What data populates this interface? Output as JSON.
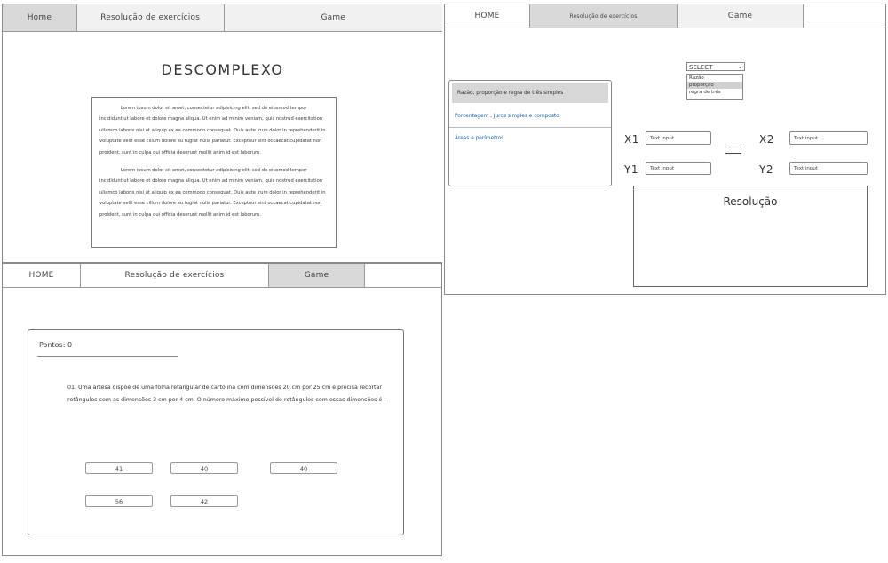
{
  "home_page": {
    "nav": [
      "Home",
      "Resolução de exercícios",
      "Game"
    ],
    "title": "DESCOMPLEXO",
    "paragraphs": [
      "Lorem ipsum dolor sit amet, consectetur adipisicing elit, sed do eiusmod tempor incididunt ut labore et dolore magna aliqua. Ut enim ad minim veniam, quis nostrud exercitation ullamco laboris nisi ut aliquip ex ea commodo consequat. Duis aute irure dolor in reprehenderit in voluptate velit esse cillum dolore eu fugiat nulla pariatur. Excepteur sint occaecat cupidatat non proident, sunt in culpa qui officia deserunt mollit anim id est laborum.",
      "Lorem ipsum dolor sit amet, consectetur adipisicing elit, sed do eiusmod tempor incididunt ut labore et dolore magna aliqua. Ut enim ad minim veniam, quis nostrud exercitation ullamco laboris nisi ut aliquip ex ea commodo consequat. Duis aute irure dolor in reprehenderit in voluptate velit esse cillum dolore eu fugiat nulla pariatur. Excepteur sint occaecat cupidatat non proident, sunt in culpa qui officia deserunt mollit anim id est laborum."
    ]
  },
  "exercises_page": {
    "nav": [
      "HOME",
      "Resolução de exercícios",
      "Game"
    ],
    "select": {
      "value": "SELECT",
      "options": [
        "Razão",
        "proporção",
        "regra de três"
      ],
      "selected_option": "proporção"
    },
    "menu_items": [
      "Razão, proporção e regra de três simples",
      "Porcentagem , Juros simples e composto",
      "Áreas e perímetros"
    ],
    "labels": {
      "x1": "X1",
      "x2": "X2",
      "y1": "Y1",
      "y2": "Y2"
    },
    "input_placeholder": "Text input",
    "result_title": "Resolução"
  },
  "game_page": {
    "nav": [
      "HOME",
      "Resolução de exercícios",
      "Game"
    ],
    "points": "Pontos: 0",
    "question": "01. Uma artesã dispõe de uma folha retangular de cartolina com dimensões 20 cm por 25 cm e precisa recortar retângulos com as dimensões  3 cm por 4 cm.  O número máximo possível de retângulos com  essas dimensões é .",
    "answers": [
      "41",
      "40",
      "40",
      "56",
      "42"
    ]
  },
  "colors": {
    "active_tab": "#d9d9d9",
    "link_text": "#1a5fa3",
    "border": "#888888"
  }
}
